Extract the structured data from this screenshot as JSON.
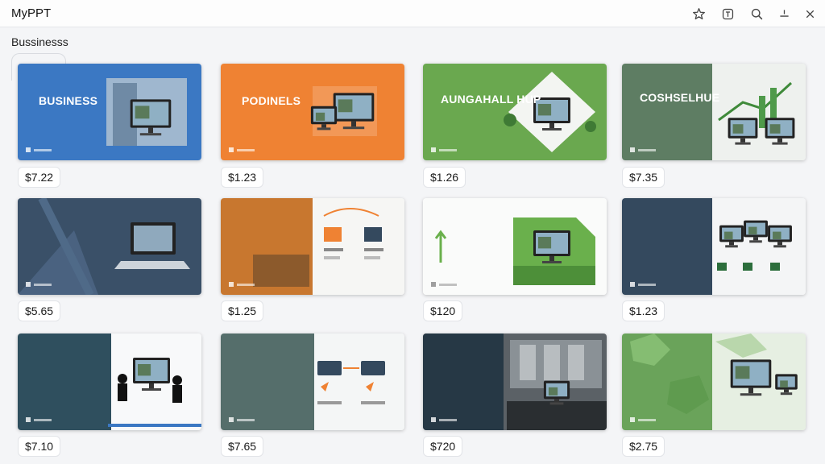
{
  "app": {
    "title": "MyPPT"
  },
  "toolbar": {
    "icons": [
      "star-icon",
      "info-icon",
      "search-icon",
      "minimize-icon",
      "close-icon"
    ]
  },
  "category": {
    "label": "Bussinesss"
  },
  "templates": [
    {
      "title": "BUSINESS",
      "price": "$7.22",
      "accent": "#3b78c3"
    },
    {
      "title": "PODINELS",
      "price": "$1.23",
      "accent": "#ef8233"
    },
    {
      "title": "AUNGAHALL HUP",
      "price": "$1.26",
      "accent": "#6aa84f"
    },
    {
      "title": "COSHSELHUE",
      "price": "$7.35",
      "accent": "#5e7d63"
    },
    {
      "title": "",
      "price": "$5.65",
      "accent": "#3a5068"
    },
    {
      "title": "",
      "price": "$1.25",
      "accent": "#c8772f"
    },
    {
      "title": "",
      "price": "$120",
      "accent": "#6ab04c"
    },
    {
      "title": "",
      "price": "$1.23",
      "accent": "#34495e"
    },
    {
      "title": "",
      "price": "$7.10",
      "accent": "#2f4f5e"
    },
    {
      "title": "",
      "price": "$7.65",
      "accent": "#556e6b"
    },
    {
      "title": "",
      "price": "$720",
      "accent": "#263845"
    },
    {
      "title": "",
      "price": "$2.75",
      "accent": "#6aa35a"
    }
  ]
}
